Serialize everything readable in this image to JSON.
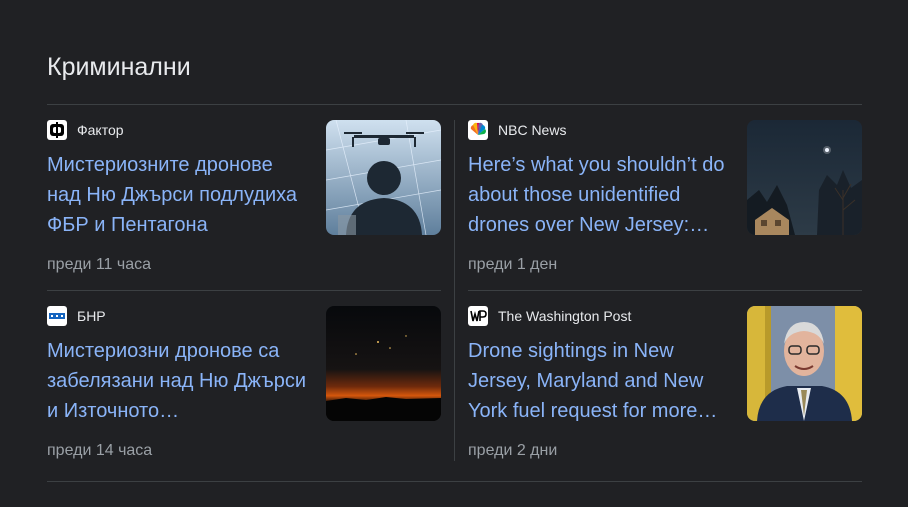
{
  "section": {
    "title": "Криминални"
  },
  "articles": [
    {
      "source": "Фактор",
      "logo": "faktor-logo",
      "headline": "Мистериозните дронове над Ню Джърси подлудиха ФБР и Пентагона",
      "time": "преди 11 часа",
      "thumbnail": "drone-operator-image"
    },
    {
      "source": "NBC News",
      "logo": "nbc-peacock-logo",
      "headline": "Here’s what you shouldn’t do about those unidentified drones over New Jersey:…",
      "time": "преди 1 ден",
      "thumbnail": "night-sky-image"
    },
    {
      "source": "БНР",
      "logo": "bnr-logo",
      "headline": "Мистериозни дронове са забелязани над Ню Джърси и Източното…",
      "time": "преди 14 часа",
      "thumbnail": "night-horizon-image"
    },
    {
      "source": "The Washington Post",
      "logo": "washington-post-logo",
      "headline": "Drone sightings in New Jersey, Maryland and New York fuel request for more…",
      "time": "преди 2 дни",
      "thumbnail": "governor-portrait-image"
    }
  ],
  "colors": {
    "background": "#202124",
    "headline": "#8ab4f8",
    "title": "#e8eaed",
    "meta": "#9aa0a6",
    "divider": "#3c4043"
  }
}
